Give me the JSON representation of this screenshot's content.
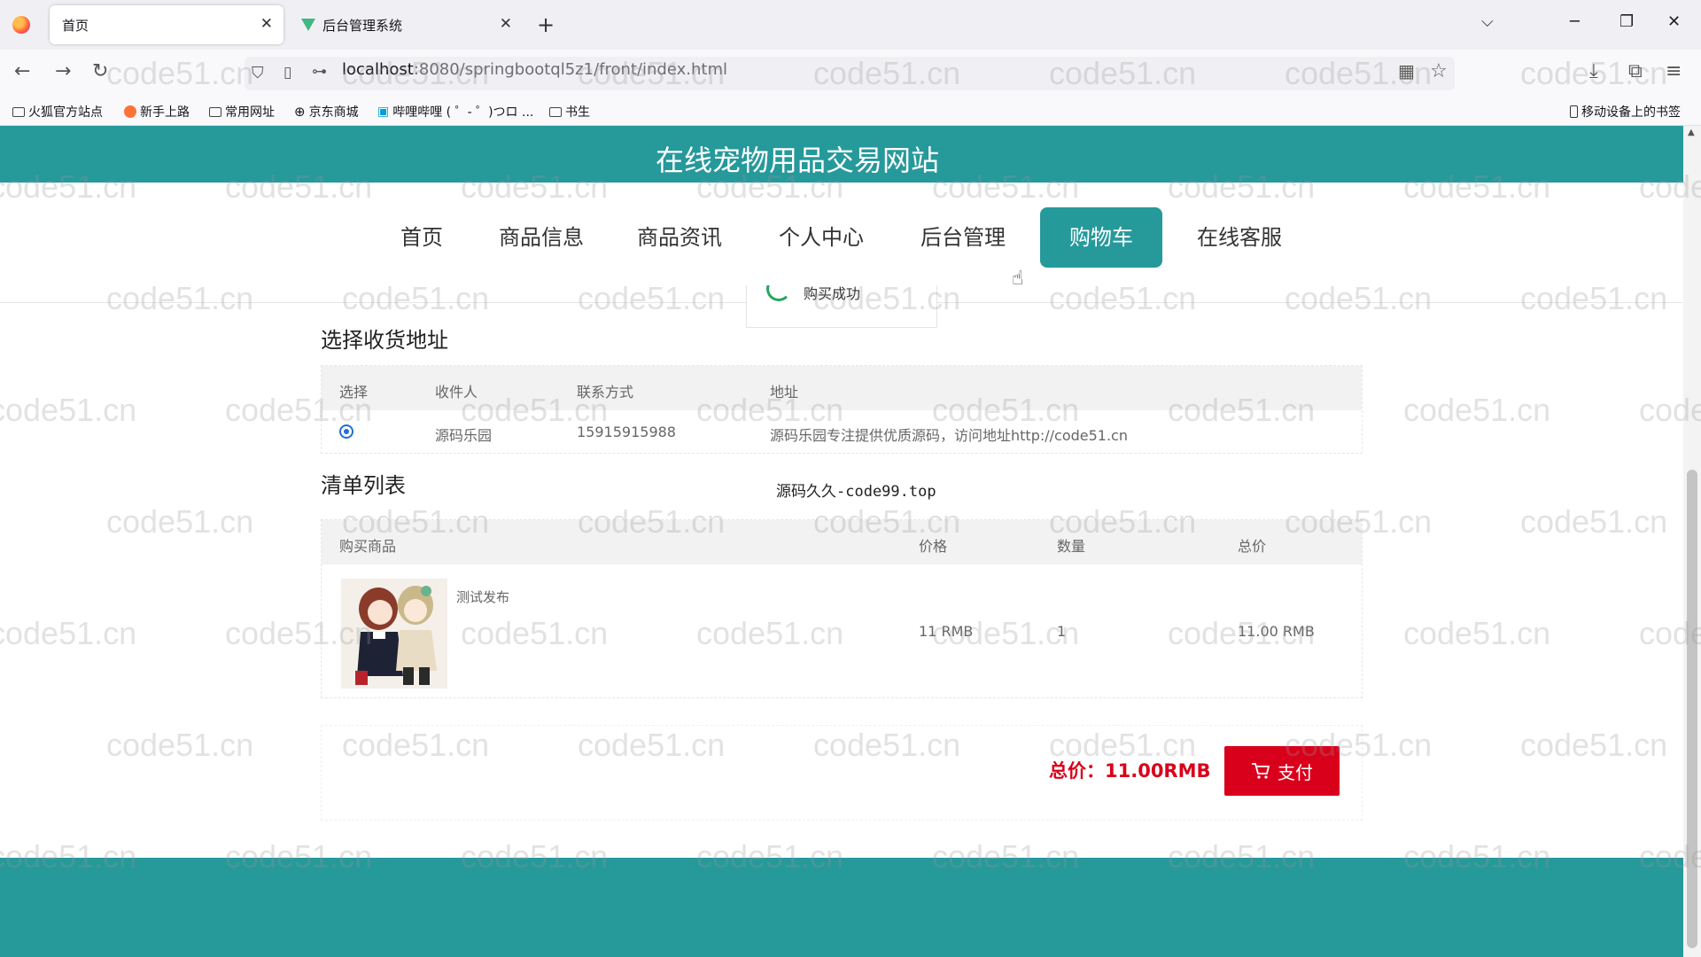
{
  "browser": {
    "tabs": [
      {
        "title": "首页",
        "active": true
      },
      {
        "title": "后台管理系统",
        "active": false
      }
    ],
    "url_host": "localhost",
    "url_path": ":8080/springbootql5z1/front/index.html",
    "bookmarks": [
      "火狐官方站点",
      "新手上路",
      "常用网址",
      "京东商城",
      "哔哩哔哩 ( ゜- ゜)つロ ...",
      "书生"
    ],
    "mobile_bookmarks": "移动设备上的书签"
  },
  "site": {
    "title": "在线宠物用品交易网站",
    "menu": [
      "首页",
      "商品信息",
      "商品资讯",
      "个人中心",
      "后台管理",
      "购物车",
      "在线客服"
    ],
    "active_menu": "购物车"
  },
  "toast": {
    "message": "购买成功"
  },
  "address_section": {
    "title": "选择收货地址",
    "headers": {
      "select": "选择",
      "receiver": "收件人",
      "contact": "联系方式",
      "address": "地址"
    },
    "rows": [
      {
        "receiver": "源码乐园",
        "contact": "15915915988",
        "address": "源码乐园专注提供优质源码，访问地址http://code51.cn",
        "selected": true
      }
    ]
  },
  "order_section": {
    "title": "清单列表",
    "note": "源码久久-code99.top",
    "headers": {
      "product": "购买商品",
      "price": "价格",
      "quantity": "数量",
      "total": "总价"
    },
    "items": [
      {
        "name": "测试发布",
        "price": "11 RMB",
        "quantity": "1",
        "total": "11.00 RMB"
      }
    ]
  },
  "summary": {
    "total_label": "总价：11.00RMB",
    "pay_label": "支付"
  },
  "watermark_text": "code51.cn",
  "colors": {
    "primary": "#26999b",
    "danger": "#d9001b",
    "radio": "#1e6fd9"
  }
}
